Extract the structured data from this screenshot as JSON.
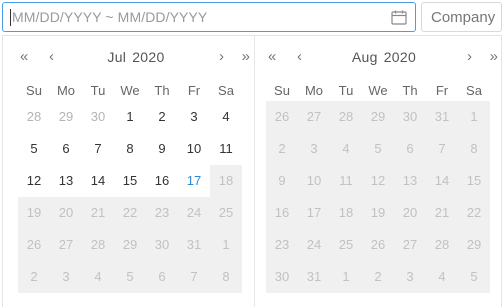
{
  "range_input": {
    "placeholder": "MM/DD/YYYY ~ MM/DD/YYYY",
    "value": ""
  },
  "company_input": {
    "value": "Company"
  },
  "weekdays": [
    "Su",
    "Mo",
    "Tu",
    "We",
    "Th",
    "Fr",
    "Sa"
  ],
  "nav": {
    "prev_year": "«",
    "prev_month": "‹",
    "next_month": "›",
    "next_year": "»"
  },
  "left_calendar": {
    "month": "Jul",
    "year": "2020",
    "days": [
      {
        "d": "28",
        "s": "muted"
      },
      {
        "d": "29",
        "s": "muted"
      },
      {
        "d": "30",
        "s": "muted"
      },
      {
        "d": "1",
        "s": ""
      },
      {
        "d": "2",
        "s": ""
      },
      {
        "d": "3",
        "s": ""
      },
      {
        "d": "4",
        "s": ""
      },
      {
        "d": "5",
        "s": ""
      },
      {
        "d": "6",
        "s": ""
      },
      {
        "d": "7",
        "s": ""
      },
      {
        "d": "8",
        "s": ""
      },
      {
        "d": "9",
        "s": ""
      },
      {
        "d": "10",
        "s": ""
      },
      {
        "d": "11",
        "s": ""
      },
      {
        "d": "12",
        "s": ""
      },
      {
        "d": "13",
        "s": ""
      },
      {
        "d": "14",
        "s": ""
      },
      {
        "d": "15",
        "s": ""
      },
      {
        "d": "16",
        "s": ""
      },
      {
        "d": "17",
        "s": "sel"
      },
      {
        "d": "18",
        "s": "dis"
      },
      {
        "d": "19",
        "s": "dis"
      },
      {
        "d": "20",
        "s": "dis"
      },
      {
        "d": "21",
        "s": "dis"
      },
      {
        "d": "22",
        "s": "dis"
      },
      {
        "d": "23",
        "s": "dis"
      },
      {
        "d": "24",
        "s": "dis"
      },
      {
        "d": "25",
        "s": "dis"
      },
      {
        "d": "26",
        "s": "dis"
      },
      {
        "d": "27",
        "s": "dis"
      },
      {
        "d": "28",
        "s": "dis"
      },
      {
        "d": "29",
        "s": "dis"
      },
      {
        "d": "30",
        "s": "dis"
      },
      {
        "d": "31",
        "s": "dis"
      },
      {
        "d": "1",
        "s": "dis"
      },
      {
        "d": "2",
        "s": "dis"
      },
      {
        "d": "3",
        "s": "dis"
      },
      {
        "d": "4",
        "s": "dis"
      },
      {
        "d": "5",
        "s": "dis"
      },
      {
        "d": "6",
        "s": "dis"
      },
      {
        "d": "7",
        "s": "dis"
      },
      {
        "d": "8",
        "s": "dis"
      }
    ]
  },
  "right_calendar": {
    "month": "Aug",
    "year": "2020",
    "days": [
      {
        "d": "26",
        "s": "dis"
      },
      {
        "d": "27",
        "s": "dis"
      },
      {
        "d": "28",
        "s": "dis"
      },
      {
        "d": "29",
        "s": "dis"
      },
      {
        "d": "30",
        "s": "dis"
      },
      {
        "d": "31",
        "s": "dis"
      },
      {
        "d": "1",
        "s": "dis"
      },
      {
        "d": "2",
        "s": "dis"
      },
      {
        "d": "3",
        "s": "dis"
      },
      {
        "d": "4",
        "s": "dis"
      },
      {
        "d": "5",
        "s": "dis"
      },
      {
        "d": "6",
        "s": "dis"
      },
      {
        "d": "7",
        "s": "dis"
      },
      {
        "d": "8",
        "s": "dis"
      },
      {
        "d": "9",
        "s": "dis"
      },
      {
        "d": "10",
        "s": "dis"
      },
      {
        "d": "11",
        "s": "dis"
      },
      {
        "d": "12",
        "s": "dis"
      },
      {
        "d": "13",
        "s": "dis"
      },
      {
        "d": "14",
        "s": "dis"
      },
      {
        "d": "15",
        "s": "dis"
      },
      {
        "d": "16",
        "s": "dis"
      },
      {
        "d": "17",
        "s": "dis"
      },
      {
        "d": "18",
        "s": "dis"
      },
      {
        "d": "19",
        "s": "dis"
      },
      {
        "d": "20",
        "s": "dis"
      },
      {
        "d": "21",
        "s": "dis"
      },
      {
        "d": "22",
        "s": "dis"
      },
      {
        "d": "23",
        "s": "dis"
      },
      {
        "d": "24",
        "s": "dis"
      },
      {
        "d": "25",
        "s": "dis"
      },
      {
        "d": "26",
        "s": "dis"
      },
      {
        "d": "27",
        "s": "dis"
      },
      {
        "d": "28",
        "s": "dis"
      },
      {
        "d": "29",
        "s": "dis"
      },
      {
        "d": "30",
        "s": "dis"
      },
      {
        "d": "31",
        "s": "dis"
      },
      {
        "d": "1",
        "s": "dis"
      },
      {
        "d": "2",
        "s": "dis"
      },
      {
        "d": "3",
        "s": "dis"
      },
      {
        "d": "4",
        "s": "dis"
      },
      {
        "d": "5",
        "s": "dis"
      }
    ]
  },
  "icons": {
    "calendar": "calendar-icon"
  },
  "colors": {
    "focus_border": "#4c9be8",
    "selected_text": "#2f89d8",
    "disabled_bg": "#f0f0f0"
  }
}
